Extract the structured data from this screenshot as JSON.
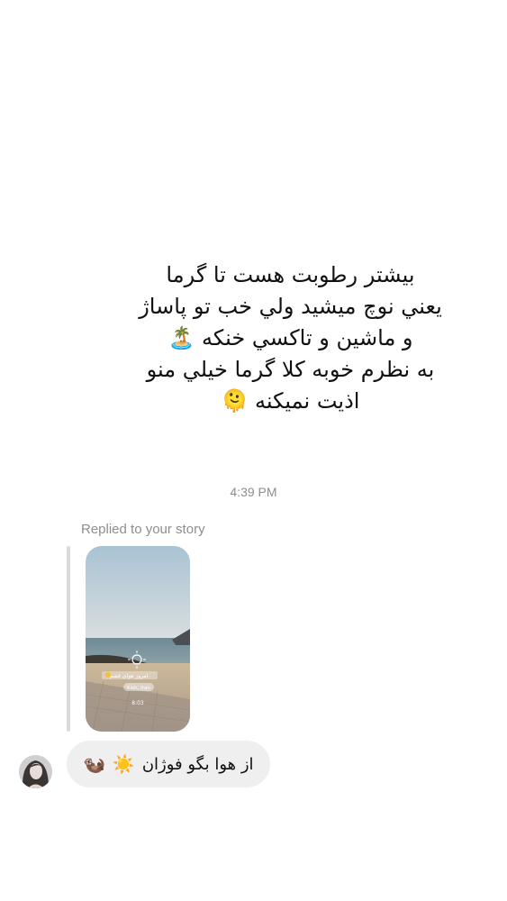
{
  "thread": {
    "own_message_lines": [
      "بيشتر رطوبت هست تا گرما",
      "يعني نوچ ميشيد ولي خب تو پاساژ",
      "و ماشين و تاكسي خنكه 🏝️",
      "به نظرم خوبه كلا گرما خيلي منو",
      "اذيت نميكنه 🫠"
    ],
    "timestamp": "4:39 PM",
    "reply_label": "Replied to your story",
    "story": {
      "overlay_line_1": "امروز هوای قشم",
      "overlay_line_2": "Kish, Iran",
      "overlay_time": "8:03"
    },
    "their_message": {
      "text": "از هوا بگو فوژان",
      "emoji_1": "☀️",
      "emoji_2": "🦦"
    }
  },
  "colors": {
    "background": "#ffffff",
    "meta_text": "#8e8e8e",
    "their_bubble": "#efefef",
    "reply_bar": "#dbdbdb"
  },
  "icons": [
    "story-thumbnail",
    "avatar"
  ]
}
